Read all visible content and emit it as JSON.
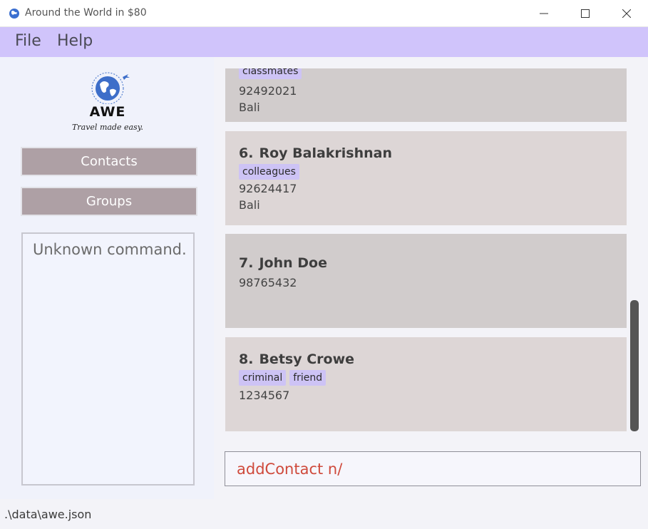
{
  "window": {
    "title": "Around the World in $80",
    "icon": "globe-icon"
  },
  "menu": {
    "file": "File",
    "help": "Help"
  },
  "logo": {
    "text": "AWE",
    "tagline": "Travel made easy."
  },
  "nav": {
    "contacts": "Contacts",
    "groups": "Groups"
  },
  "result": {
    "message": "Unknown command."
  },
  "contacts": [
    {
      "index": "",
      "name": "",
      "tags": [
        "classmates"
      ],
      "phone": "92492021",
      "location": "Bali"
    },
    {
      "index": "6.",
      "name": "Roy Balakrishnan",
      "tags": [
        "colleagues"
      ],
      "phone": "92624417",
      "location": "Bali"
    },
    {
      "index": "7.",
      "name": "John Doe",
      "tags": [],
      "phone": "98765432",
      "location": ""
    },
    {
      "index": "8.",
      "name": "Betsy Crowe",
      "tags": [
        "criminal",
        "friend"
      ],
      "phone": "1234567",
      "location": ""
    }
  ],
  "command": {
    "value": "addContact n/"
  },
  "status": {
    "path": ".\\data\\awe.json"
  },
  "colors": {
    "menubar": "#d0c4fb",
    "nav_button": "#aea0a5",
    "tag": "#cdc3f5",
    "command_text": "#cf4a3c"
  }
}
